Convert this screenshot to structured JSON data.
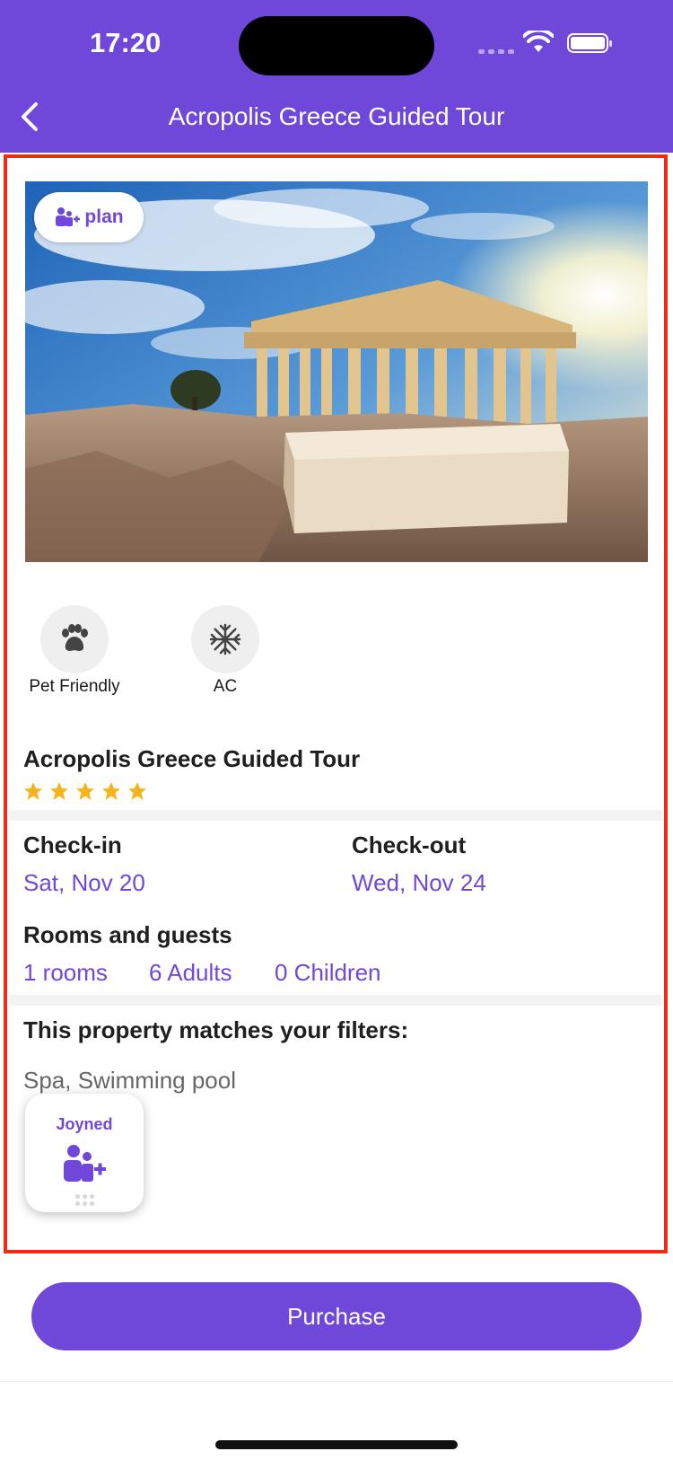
{
  "status_bar": {
    "time": "17:20"
  },
  "header": {
    "title": "Acropolis Greece Guided Tour"
  },
  "hero": {
    "badge_label": "plan"
  },
  "amenities": [
    {
      "label": "Pet Friendly",
      "icon": "paw-icon"
    },
    {
      "label": "AC",
      "icon": "snowflake-icon"
    }
  ],
  "property": {
    "name": "Acropolis Greece Guided Tour",
    "star_rating": 5
  },
  "dates": {
    "checkin_label": "Check-in",
    "checkin_value": "Sat, Nov 20",
    "checkout_label": "Check-out",
    "checkout_value": "Wed, Nov 24"
  },
  "guests": {
    "label": "Rooms and guests",
    "rooms": "1 rooms",
    "adults": "6 Adults",
    "children": "0 Children"
  },
  "filters": {
    "label": "This property matches your filters:",
    "value": "Spa, Swimming pool"
  },
  "joyned_widget": {
    "label": "Joyned"
  },
  "footer": {
    "purchase_label": "Purchase"
  },
  "colors": {
    "accent": "#7048d9",
    "highlight_border": "#f22a12",
    "star": "#f5b41e"
  }
}
